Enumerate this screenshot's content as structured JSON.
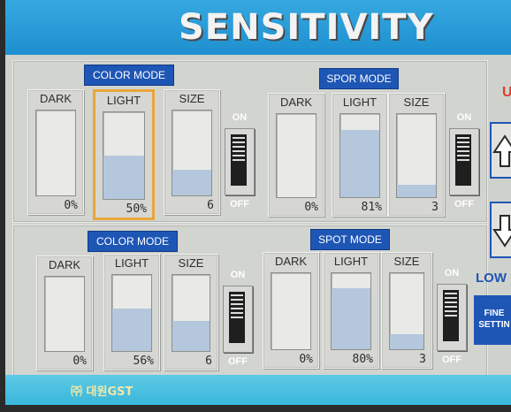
{
  "title": "SENSITIVITY",
  "top_panel": {
    "color_mode": {
      "label": "COLOR MODE",
      "cards": [
        {
          "label": "DARK",
          "value": "0%",
          "level": 0
        },
        {
          "label": "LIGHT",
          "value": "50%",
          "level": 0.5,
          "selected": true
        },
        {
          "label": "SIZE",
          "value": "6",
          "level": 0.3
        }
      ],
      "toggle": {
        "on": "ON",
        "off": "OFF"
      }
    },
    "spot_mode": {
      "label": "SPOR MODE",
      "cards": [
        {
          "label": "DARK",
          "value": "0%",
          "level": 0
        },
        {
          "label": "LIGHT",
          "value": "81%",
          "level": 0.81
        },
        {
          "label": "SIZE",
          "value": "3",
          "level": 0.15
        }
      ],
      "toggle": {
        "on": "ON",
        "off": "OFF"
      }
    }
  },
  "bottom_panel": {
    "color_mode": {
      "label": "COLOR MODE",
      "cards": [
        {
          "label": "DARK",
          "value": "0%",
          "level": 0
        },
        {
          "label": "LIGHT",
          "value": "56%",
          "level": 0.56
        },
        {
          "label": "SIZE",
          "value": "6",
          "level": 0.4
        }
      ],
      "toggle": {
        "on": "ON",
        "off": "OFF"
      }
    },
    "spot_mode": {
      "label": "SPOT MODE",
      "cards": [
        {
          "label": "DARK",
          "value": "0%",
          "level": 0
        },
        {
          "label": "LIGHT",
          "value": "80%",
          "level": 0.8
        },
        {
          "label": "SIZE",
          "value": "3",
          "level": 0.2
        }
      ],
      "toggle": {
        "on": "ON",
        "off": "OFF"
      }
    }
  },
  "side": {
    "up_label": "U",
    "up_icon": "arrow-up-icon",
    "down_icon": "arrow-down-icon",
    "low_label": "LOW",
    "fine_label_line1": "FINE",
    "fine_label_line2": "SETTIN"
  },
  "footer": {
    "logo_text": "㈜ 대원GST"
  },
  "colors": {
    "title_bar": "#1f8fcf",
    "mode_label_bg": "#1e56b5",
    "bar_fill": "#b4c7dd",
    "selected_border": "#e9a53a",
    "up_label": "#e23a2a",
    "footer": "#39b7da"
  }
}
